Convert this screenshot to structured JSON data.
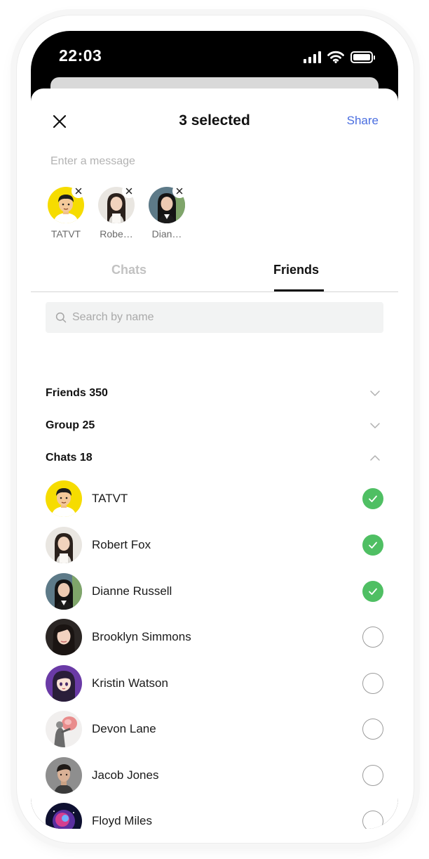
{
  "status_bar": {
    "time": "22:03"
  },
  "header": {
    "title": "3 selected",
    "share_label": "Share"
  },
  "message": {
    "placeholder": "Enter a message",
    "value": ""
  },
  "selected_chips": [
    {
      "label": "TATVT"
    },
    {
      "label": "Robe…"
    },
    {
      "label": "Dian…"
    }
  ],
  "tabs": {
    "chats_label": "Chats",
    "friends_label": "Friends",
    "active": "Friends"
  },
  "search": {
    "placeholder": "Search by name",
    "value": ""
  },
  "sections": {
    "friends_label": "Friends 350",
    "group_label": "Group 25",
    "chats_label": "Chats 18"
  },
  "list": [
    {
      "name": "TATVT",
      "selected": true
    },
    {
      "name": "Robert Fox",
      "selected": true
    },
    {
      "name": "Dianne Russell",
      "selected": true
    },
    {
      "name": "Brooklyn Simmons",
      "selected": false
    },
    {
      "name": "Kristin Watson",
      "selected": false
    },
    {
      "name": "Devon Lane",
      "selected": false
    },
    {
      "name": "Jacob Jones",
      "selected": false
    },
    {
      "name": "Floyd Miles",
      "selected": false
    }
  ],
  "colors": {
    "accent": "#4a6ee0",
    "check_green": "#4fbf63",
    "tab_inactive": "#c2c2c2",
    "search_bg": "#f2f3f3"
  }
}
